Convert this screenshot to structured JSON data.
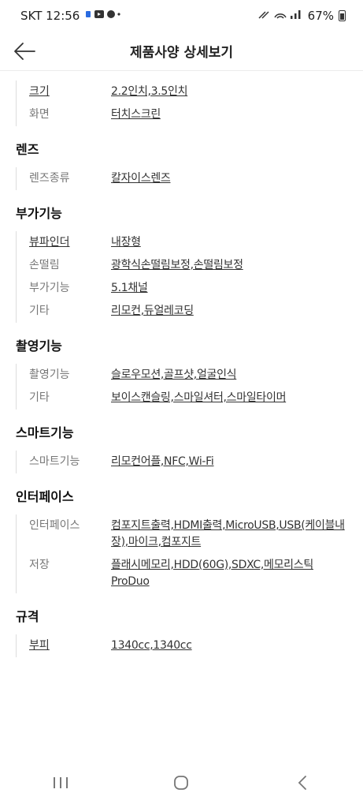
{
  "status_bar": {
    "carrier_time": "SKT 12:56",
    "battery": "67%"
  },
  "header": {
    "title": "제품사양 상세보기"
  },
  "first_group": [
    {
      "label": "크기",
      "value": "2.2인치,3.5인치",
      "label_link": true
    },
    {
      "label": "화면",
      "value": "터치스크린",
      "label_link": false
    }
  ],
  "sections": [
    {
      "title": "렌즈",
      "rows": [
        {
          "label": "렌즈종류",
          "value": "칼자이스렌즈",
          "label_link": false
        }
      ]
    },
    {
      "title": "부가기능",
      "rows": [
        {
          "label": "뷰파인더",
          "value": "내장형",
          "label_link": true
        },
        {
          "label": "손떨림",
          "value": "광학식손떨림보정,손떨림보정",
          "label_link": false
        },
        {
          "label": "부가기능",
          "value": "5.1채널",
          "label_link": false
        },
        {
          "label": "기타",
          "value": "리모컨,듀얼레코딩",
          "label_link": false
        }
      ]
    },
    {
      "title": "촬영기능",
      "rows": [
        {
          "label": "촬영기능",
          "value": "슬로우모션,골프샷,얼굴인식",
          "label_link": false
        },
        {
          "label": "기타",
          "value": "보이스캔슬링,스마일셔터,스마일타이머",
          "label_link": false
        }
      ]
    },
    {
      "title": "스마트기능",
      "rows": [
        {
          "label": "스마트기능",
          "value": "리모컨어플,NFC,Wi-Fi",
          "label_link": false
        }
      ]
    },
    {
      "title": "인터페이스",
      "rows": [
        {
          "label": "인터페이스",
          "value": "컴포지트출력,HDMI출력,MicroUSB,USB(케이블내장),마이크,컴포지트",
          "label_link": false
        },
        {
          "label": "저장",
          "value": "플래시메모리,HDD(60G),SDXC,메모리스틱ProDuo",
          "label_link": false
        }
      ]
    },
    {
      "title": "규격",
      "rows": [
        {
          "label": "부피",
          "value": "1340cc,1340cc",
          "label_link": true
        }
      ]
    }
  ]
}
